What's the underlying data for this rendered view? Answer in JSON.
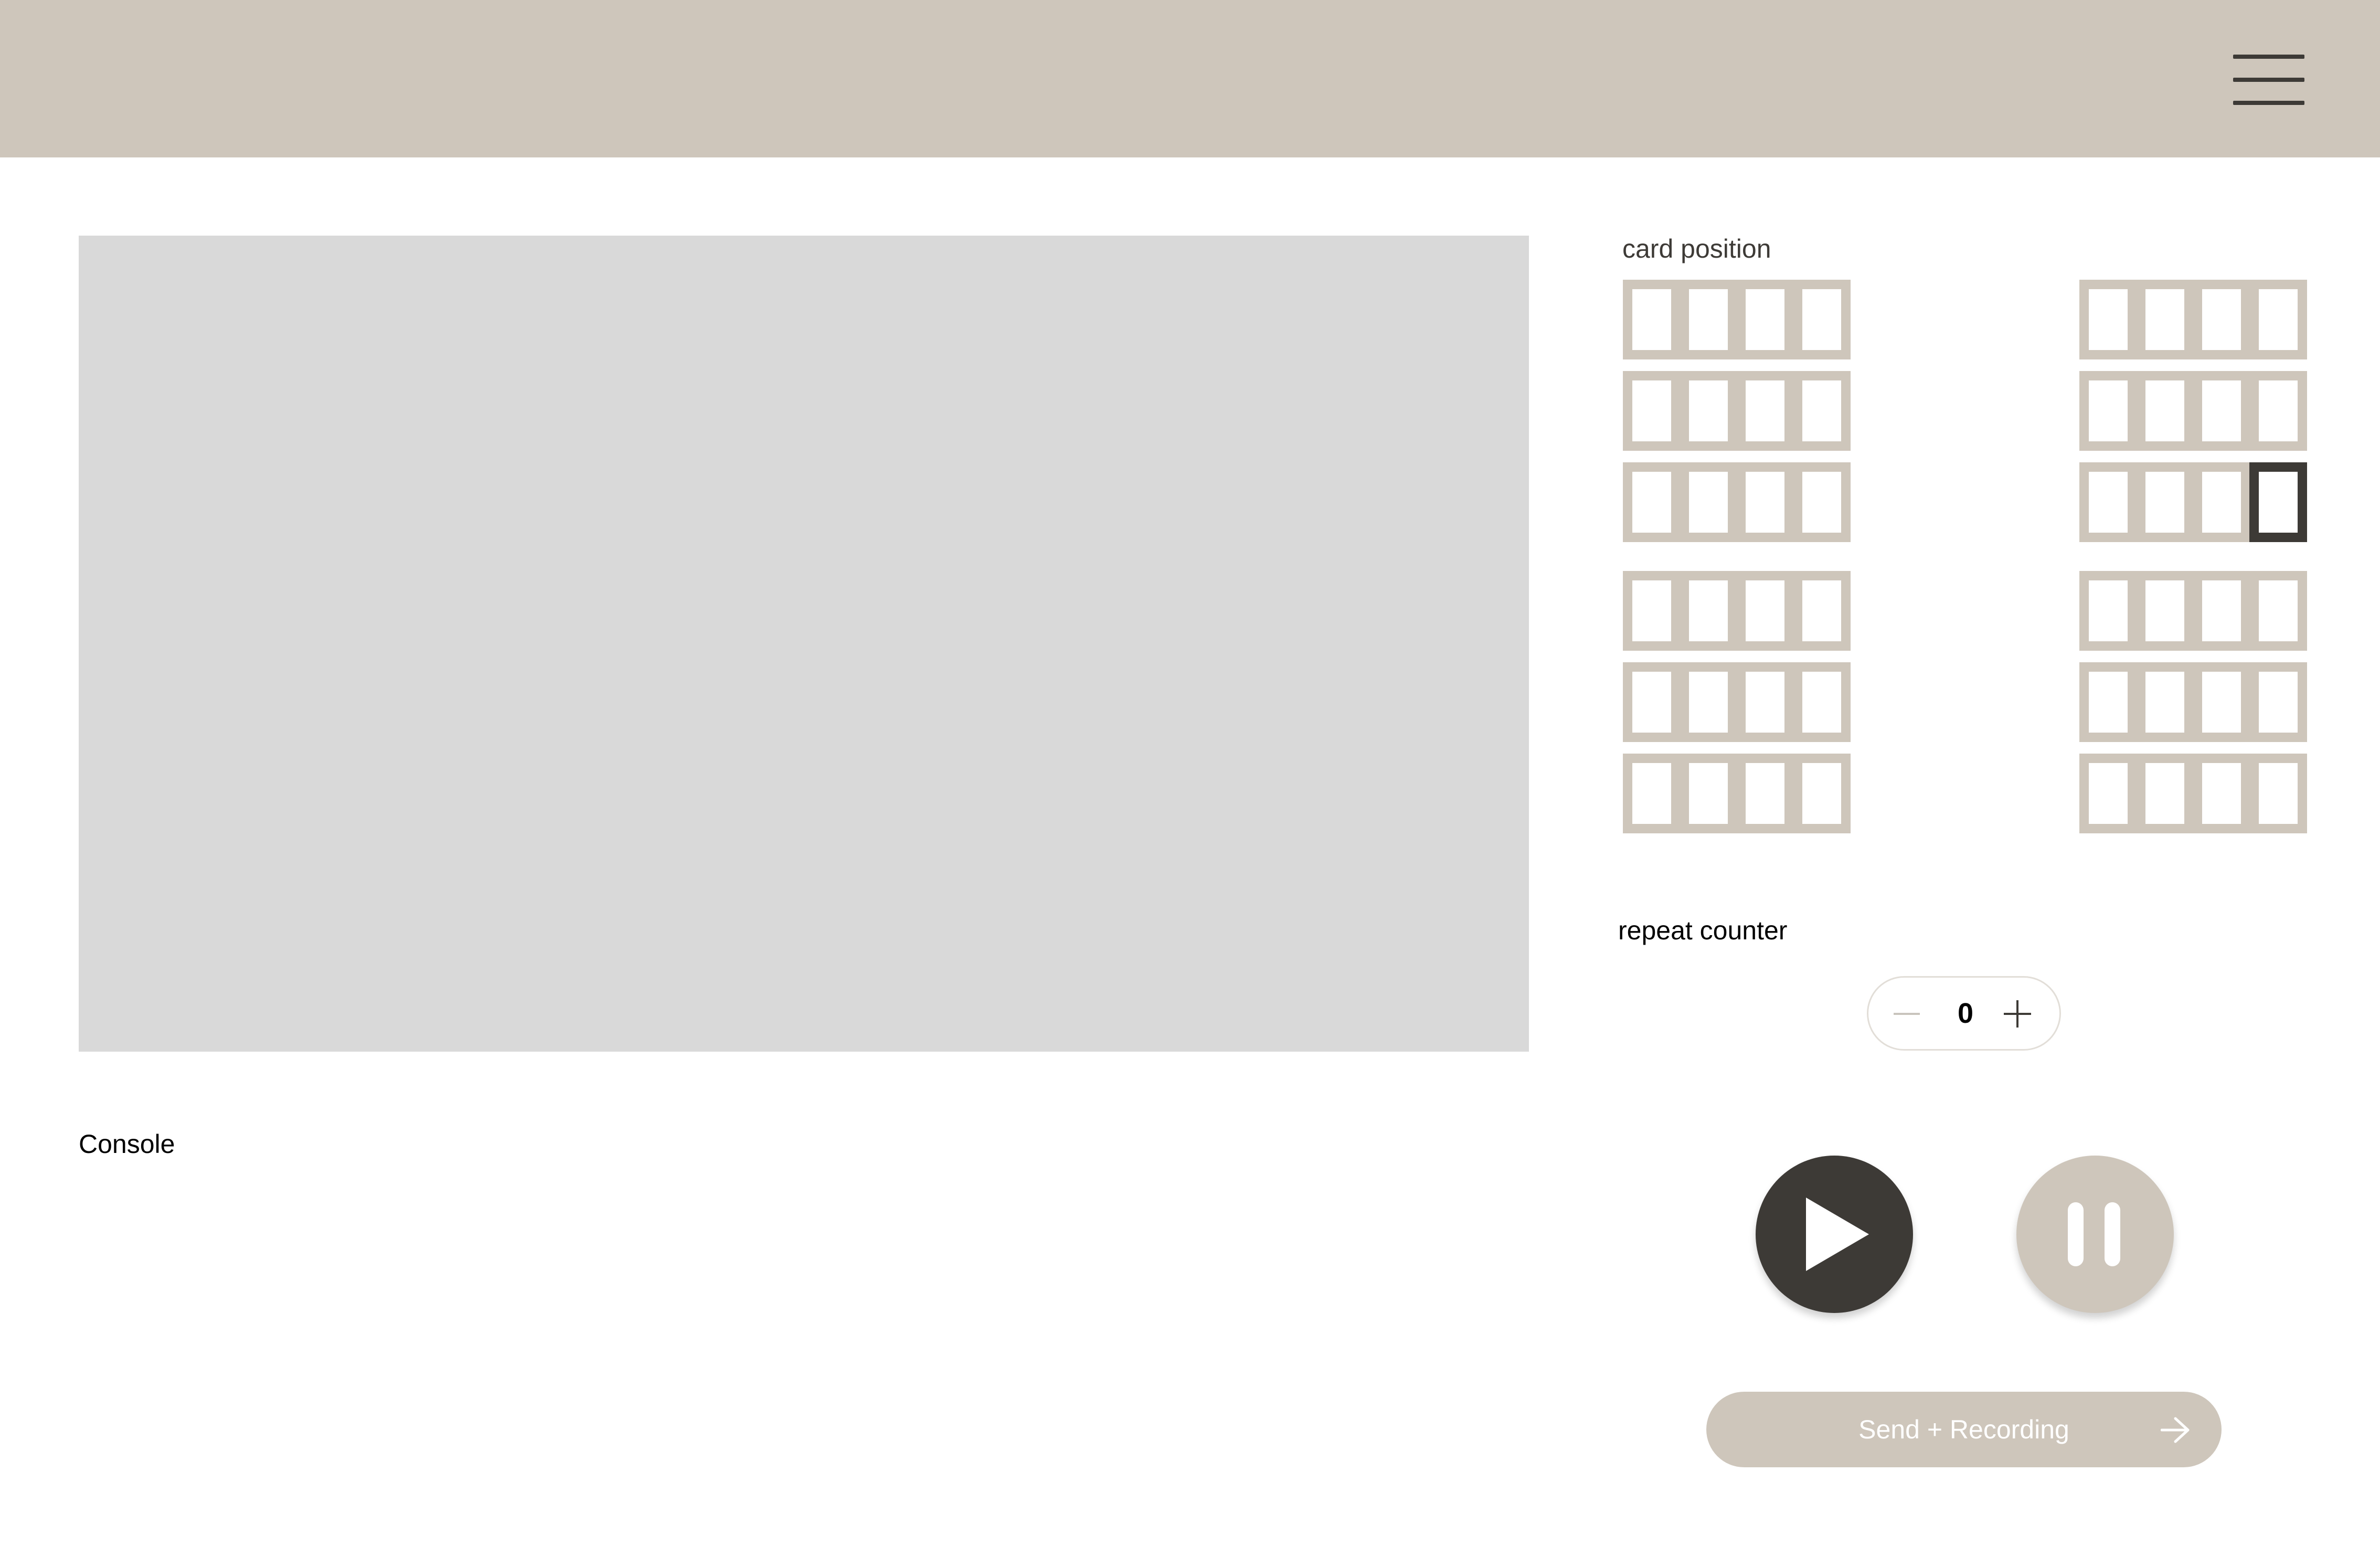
{
  "header": {
    "menu_icon": "hamburger-menu-icon",
    "background_color": "#cec6bb"
  },
  "main": {
    "preview_color": "#d9d9d9",
    "console_label": "Console"
  },
  "card_position": {
    "label": "card position",
    "groups_per_column": 6,
    "slots_per_group": 4,
    "selected": {
      "column": "right",
      "group": 3,
      "slot": 4
    }
  },
  "repeat_counter": {
    "label": "repeat counter",
    "value": "0",
    "decrement_icon": "minus-icon",
    "increment_icon": "plus-icon"
  },
  "controls": {
    "play_icon": "play-icon",
    "pause_icon": "pause-icon",
    "send_label": "Send + Recording",
    "send_icon": "arrow-right-icon"
  },
  "colors": {
    "accent": "#cec6bb",
    "dark": "#3d3a36",
    "white": "#ffffff"
  }
}
